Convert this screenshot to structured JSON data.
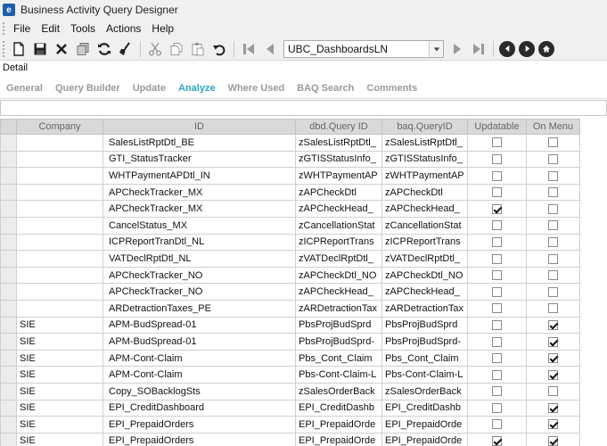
{
  "window": {
    "title": "Business Activity Query Designer",
    "app_icon_letter": "e"
  },
  "menu": {
    "items": [
      "File",
      "Edit",
      "Tools",
      "Actions",
      "Help"
    ]
  },
  "toolbar": {
    "record_combo_value": "UBC_DashboardsLN",
    "icons": [
      "new-icon",
      "save-icon",
      "delete-icon",
      "copy-icon",
      "refresh-icon",
      "clear-icon",
      "cut-icon",
      "copy-clipboard-icon",
      "paste-icon",
      "undo-icon",
      "first-record-icon",
      "previous-record-icon",
      "next-record-icon",
      "last-record-icon",
      "back-icon",
      "forward-icon",
      "home-icon"
    ]
  },
  "section_label": "Detail",
  "tabs": [
    {
      "label": "General",
      "active": false
    },
    {
      "label": "Query Builder",
      "active": false
    },
    {
      "label": "Update",
      "active": false
    },
    {
      "label": "Analyze",
      "active": true
    },
    {
      "label": "Where Used",
      "active": false
    },
    {
      "label": "BAQ Search",
      "active": false
    },
    {
      "label": "Comments",
      "active": false
    }
  ],
  "grid": {
    "columns": [
      "Company",
      "ID",
      "dbd.Query ID",
      "baq.QueryID",
      "Updatable",
      "On Menu"
    ],
    "rows": [
      {
        "company": "",
        "id": "SalesListRptDtl_BE",
        "dbd": "zSalesListRptDtl_",
        "baq": "zSalesListRptDtl_",
        "updatable": false,
        "on_menu": false
      },
      {
        "company": "",
        "id": "GTI_StatusTracker",
        "dbd": "zGTISStatusInfo_",
        "baq": "zGTISStatusInfo_",
        "updatable": false,
        "on_menu": false
      },
      {
        "company": "",
        "id": "WHTPaymentAPDtl_IN",
        "dbd": "zWHTPaymentAP",
        "baq": "zWHTPaymentAP",
        "updatable": false,
        "on_menu": false
      },
      {
        "company": "",
        "id": "APCheckTracker_MX",
        "dbd": "zAPCheckDtl",
        "baq": "zAPCheckDtl",
        "updatable": false,
        "on_menu": false
      },
      {
        "company": "",
        "id": "APCheckTracker_MX",
        "dbd": "zAPCheckHead_",
        "baq": "zAPCheckHead_",
        "updatable": true,
        "on_menu": false
      },
      {
        "company": "",
        "id": "CancelStatus_MX",
        "dbd": "zCancellationStat",
        "baq": "zCancellationStat",
        "updatable": false,
        "on_menu": false
      },
      {
        "company": "",
        "id": "ICPReportTranDtl_NL",
        "dbd": "zICPReportTrans",
        "baq": "zICPReportTrans",
        "updatable": false,
        "on_menu": false
      },
      {
        "company": "",
        "id": "VATDeclRptDtl_NL",
        "dbd": "zVATDeclRptDtl_",
        "baq": "zVATDeclRptDtl_",
        "updatable": false,
        "on_menu": false
      },
      {
        "company": "",
        "id": "APCheckTracker_NO",
        "dbd": "zAPCheckDtl_NO",
        "baq": "zAPCheckDtl_NO",
        "updatable": false,
        "on_menu": false
      },
      {
        "company": "",
        "id": "APCheckTracker_NO",
        "dbd": "zAPCheckHead_",
        "baq": "zAPCheckHead_",
        "updatable": false,
        "on_menu": false
      },
      {
        "company": "",
        "id": "ARDetractionTaxes_PE",
        "dbd": "zARDetractionTax",
        "baq": "zARDetractionTax",
        "updatable": false,
        "on_menu": false
      },
      {
        "company": "SIE",
        "id": "APM-BudSpread-01",
        "dbd": "PbsProjBudSprd",
        "baq": "PbsProjBudSprd",
        "updatable": false,
        "on_menu": true
      },
      {
        "company": "SIE",
        "id": "APM-BudSpread-01",
        "dbd": "PbsProjBudSprd-",
        "baq": "PbsProjBudSprd-",
        "updatable": false,
        "on_menu": true
      },
      {
        "company": "SIE",
        "id": "APM-Cont-Claim",
        "dbd": "Pbs_Cont_Claim",
        "baq": "Pbs_Cont_Claim",
        "updatable": false,
        "on_menu": true
      },
      {
        "company": "SIE",
        "id": "APM-Cont-Claim",
        "dbd": "Pbs-Cont-Claim-L",
        "baq": "Pbs-Cont-Claim-L",
        "updatable": false,
        "on_menu": true
      },
      {
        "company": "SIE",
        "id": "Copy_SOBacklogSts",
        "dbd": "zSalesOrderBack",
        "baq": "zSalesOrderBack",
        "updatable": false,
        "on_menu": false
      },
      {
        "company": "SIE",
        "id": "EPI_CreditDashboard",
        "dbd": "EPI_CreditDashb",
        "baq": "EPI_CreditDashb",
        "updatable": false,
        "on_menu": true
      },
      {
        "company": "SIE",
        "id": "EPI_PrepaidOrders",
        "dbd": "EPI_PrepaidOrde",
        "baq": "EPI_PrepaidOrde",
        "updatable": false,
        "on_menu": true
      },
      {
        "company": "SIE",
        "id": "EPI_PrepaidOrders",
        "dbd": "EPI_PrepaidOrde",
        "baq": "EPI_PrepaidOrde",
        "updatable": true,
        "on_menu": true
      }
    ]
  }
}
